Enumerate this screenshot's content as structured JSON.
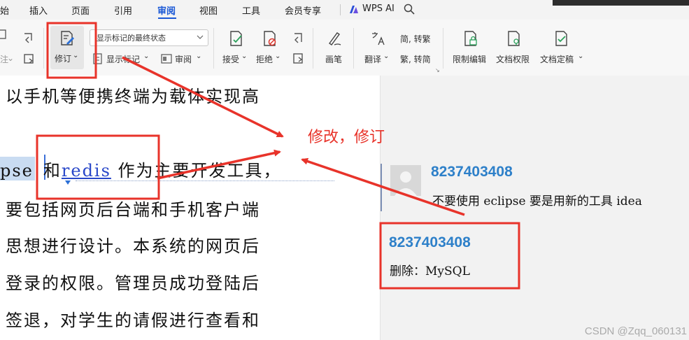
{
  "menubar": {
    "items": [
      "始",
      "插入",
      "页面",
      "引用",
      "审阅",
      "视图",
      "工具",
      "会员专享"
    ],
    "active_index": 4,
    "wps_ai": "WPS AI",
    "accent_color": "#1a58d6"
  },
  "ribbon": {
    "partial_left_label": "注",
    "revise_label": "修订",
    "markup_combo_value": "显示标记的最终状态",
    "show_markup_label": "显示标记",
    "review_pane_label": "审阅",
    "accept_label": "接受",
    "reject_label": "拒绝",
    "pen_label": "画笔",
    "translate_label": "翻译",
    "to_traditional_label": "简, 转繁",
    "to_simplified_label": "繁, 转简",
    "restrict_edit_label": "限制编辑",
    "doc_permission_label": "文档权限",
    "doc_finalize_label": "文档定稿"
  },
  "document": {
    "line1": "以手机等便携终端为载体实现高",
    "line2_selected": "pse",
    "line2_join": "和",
    "line2_inserted": "redis",
    "line2_rest": " 作为主要开发工具，",
    "line3": "要包括网页后台端和手机客户端",
    "line4": "思想进行设计。本系统的网页后",
    "line5": "登录的权限。管理员成功登陆后",
    "line6": "签退，对学生的请假进行查看和"
  },
  "comments": [
    {
      "author": "8237403408",
      "text": "不要使用 eclipse 要是用新的工具 idea"
    },
    {
      "author": "8237403408",
      "text": "删除：MySQL"
    }
  ],
  "annotation": {
    "label": "修改，修订",
    "color": "#e8332a"
  },
  "watermark": "CSDN @Zqq_060131"
}
